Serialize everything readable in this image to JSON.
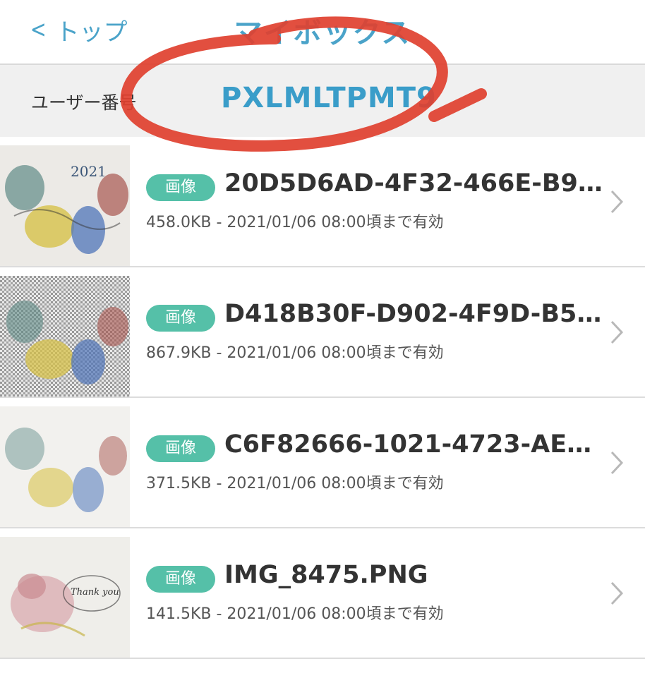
{
  "nav": {
    "back_label": "トップ",
    "title": "マイボックス"
  },
  "user": {
    "label": "ユーザー番号",
    "id": "PXLMLTPMT9"
  },
  "files": [
    {
      "badge": "画像",
      "name": "20D5D6AD-4F32-466E-B9…",
      "meta": "458.0KB - 2021/01/06 08:00頃まで有効"
    },
    {
      "badge": "画像",
      "name": "D418B30F-D902-4F9D-B5…",
      "meta": "867.9KB - 2021/01/06 08:00頃まで有効"
    },
    {
      "badge": "画像",
      "name": "C6F82666-1021-4723-AE…",
      "meta": "371.5KB - 2021/01/06 08:00頃まで有効"
    },
    {
      "badge": "画像",
      "name": "IMG_8475.PNG",
      "meta": "141.5KB - 2021/01/06 08:00頃まで有効"
    }
  ],
  "thumb_text": {
    "year": "2021",
    "greeting": "Thank you"
  },
  "colors": {
    "accent": "#4aa3c9",
    "badge": "#55c0a8",
    "annotation": "#e0402f"
  }
}
